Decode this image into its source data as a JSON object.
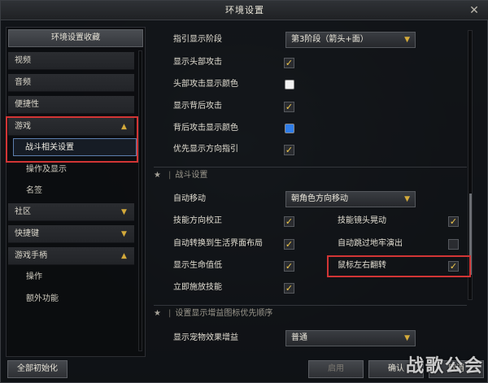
{
  "window": {
    "title": "环境设置"
  },
  "sidebar": {
    "favorites_label": "环境设置收藏",
    "items": [
      {
        "label": "视频"
      },
      {
        "label": "音频"
      },
      {
        "label": "便捷性"
      },
      {
        "label": "游戏"
      },
      {
        "label": "战斗相关设置"
      },
      {
        "label": "操作及显示"
      },
      {
        "label": "名签"
      },
      {
        "label": "社区"
      },
      {
        "label": "快捷键"
      },
      {
        "label": "游戏手柄"
      },
      {
        "label": "操作"
      },
      {
        "label": "额外功能"
      }
    ]
  },
  "settings": {
    "guide_stage_label": "指引显示阶段",
    "guide_stage_value": "第3阶段（箭头+面）",
    "show_head_attack": "显示头部攻击",
    "head_attack_color": "头部攻击显示颜色",
    "show_back_attack": "显示背后攻击",
    "back_attack_color": "背后攻击显示颜色",
    "priority_direction": "优先显示方向指引",
    "head_color_hex": "#f2f2f2",
    "back_color_hex": "#2f7de8"
  },
  "combat": {
    "section_title": "战斗设置",
    "auto_move_label": "自动移动",
    "auto_move_value": "朝角色方向移动",
    "skill_dir_correct": "技能方向校正",
    "skill_camera_shake": "技能镜头晃动",
    "auto_switch_layout": "自动转换到生活界面布局",
    "auto_skip_dungeon": "自动跳过地牢演出",
    "show_low_hp": "显示生命值低",
    "mouse_lr_flip": "鼠标左右翻转",
    "instant_cast": "立即施放技能"
  },
  "buff": {
    "section_title": "设置显示增益图标优先顺序",
    "pet_effect_label": "显示宠物效果增益",
    "pet_effect_value": "普通"
  },
  "footer": {
    "reset_all": "全部初始化",
    "apply": "启用",
    "confirm": "确认",
    "cancel": "取消"
  },
  "watermark": "战歌公会",
  "accent": {
    "check": "#f2c94c",
    "highlight": "#d23535",
    "chevron": "#d3a93a"
  }
}
